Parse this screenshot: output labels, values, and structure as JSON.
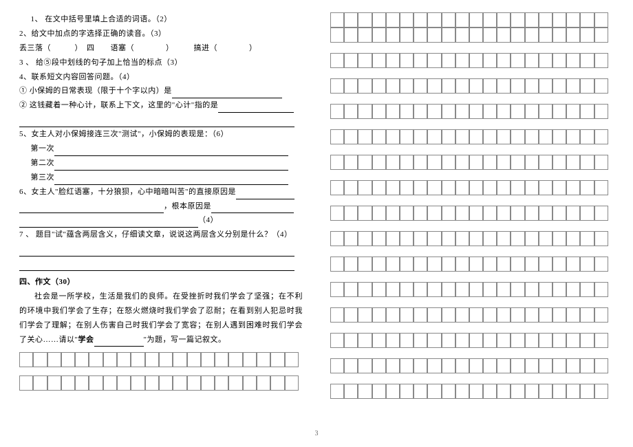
{
  "q1": {
    "num": "1、",
    "text": "在文中括号里填上合适的词语。（2）"
  },
  "q2": {
    "num": "2、",
    "text": "给文中加点的字选择正确的读音。（3）",
    "item1a": "丢三落",
    "item1b": "（　　　）　四　　语塞（　　　　）　　　搞进（　　　　）"
  },
  "q3": {
    "num": "3 、",
    "text": "给⑤段中划线的句子加上恰当的标点（3）"
  },
  "q4": {
    "num": "4、",
    "text": "联系短文内容回答问题。（4）",
    "sub1num": "①",
    "sub1text": "小保姆的日常表现（限于十个字以内）是",
    "sub2num": "②",
    "sub2text": "这钱藏着一种心计，联系上下文，这里的\"心计\"指的是"
  },
  "q5": {
    "num": "5、",
    "text": "女主人对小保姆接连三次\"测试\"，小保姆的表现是：（6）",
    "first": "第一次",
    "second": "第二次",
    "third": "第三次"
  },
  "q6": {
    "num": "6、",
    "text_a": "女主人\"脸红语塞，十分狼狈，心中暗暗叫苦\"的直接原因是",
    "text_b": "，根本原因是",
    "text_c": "（4）"
  },
  "q7": {
    "num": "7 、",
    "text": "题目\"试\"蕴含两层含义，仔细读文章，说说这两层含义分别是什么？（4）"
  },
  "essay": {
    "heading": "四、作文（30）",
    "body1": "社会是一所学校，生活是我们的良师。在受挫折时我们学会了坚强；在不利的环境中我们学会了生存；在怒火燃烧时我们学会了忍耐；在看到别人犯忌时我们学会了理解；在别人伤害自己时我们学会了宽容；在别人遇到困难时我们学会了关心……请以\"",
    "body_bold": "学会",
    "body2": "\"为题，写一篇记叙文。"
  },
  "page_number": "3",
  "left_grid": {
    "rows": 2,
    "cols": 20
  },
  "right_grid": {
    "rows_count": 14,
    "double_rows": 1,
    "cols": 20
  }
}
